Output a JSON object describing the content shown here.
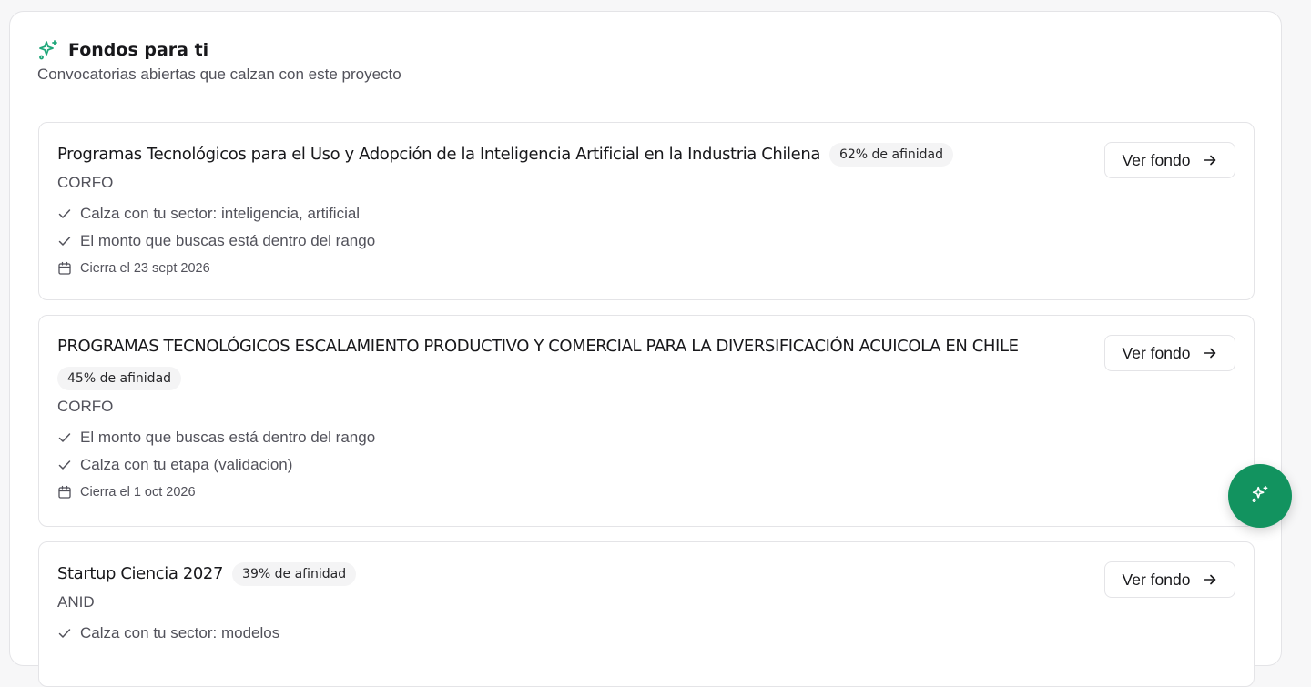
{
  "section": {
    "title": "Fondos para ti",
    "subtitle": "Convocatorias abiertas que calzan con este proyecto",
    "icon": "sparkles-icon",
    "accent_color": "#1fa77a"
  },
  "funds": [
    {
      "title": "Programas Tecnológicos para el Uso y Adopción de la Inteligencia Artificial en la Industria Chilena",
      "affinity": "62% de afinidad",
      "agency": "CORFO",
      "reasons": [
        "Calza con tu sector: inteligencia, artificial",
        "El monto que buscas está dentro del rango"
      ],
      "deadline": "Cierra el 23 sept 2026",
      "button_label": "Ver fondo"
    },
    {
      "title": "PROGRAMAS TECNOLÓGICOS ESCALAMIENTO PRODUCTIVO Y COMERCIAL PARA LA DIVERSIFICACIÓN ACUICOLA EN CHILE",
      "affinity": "45% de afinidad",
      "agency": "CORFO",
      "reasons": [
        "El monto que buscas está dentro del rango",
        "Calza con tu etapa (validacion)"
      ],
      "deadline": "Cierra el 1 oct 2026",
      "button_label": "Ver fondo"
    },
    {
      "title": "Startup Ciencia 2027",
      "affinity": "39% de afinidad",
      "agency": "ANID",
      "reasons": [
        "Calza con tu sector: modelos"
      ],
      "button_label": "Ver fondo"
    }
  ],
  "fab": {
    "icon": "sparkles-icon",
    "color": "#12935f"
  }
}
